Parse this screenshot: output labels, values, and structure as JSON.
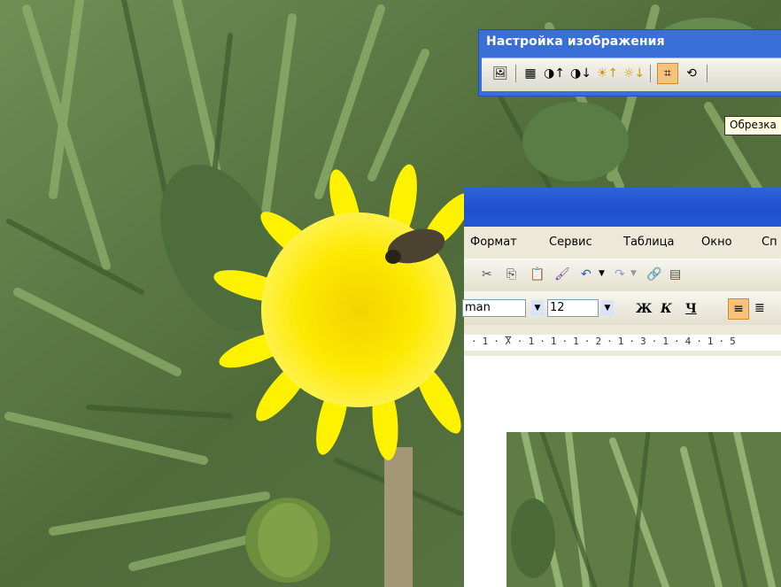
{
  "background": {
    "description_icon": "dandelion-photo"
  },
  "picture_toolbar": {
    "title": "Настройка изображения",
    "buttons": [
      {
        "name": "insert-picture-icon",
        "glyph": "🖼"
      },
      {
        "name": "color-icon",
        "glyph": "▦"
      },
      {
        "name": "more-contrast-icon",
        "glyph": "◑↑"
      },
      {
        "name": "less-contrast-icon",
        "glyph": "◑↓"
      },
      {
        "name": "more-brightness-icon",
        "glyph": "☀↑"
      },
      {
        "name": "less-brightness-icon",
        "glyph": "☼↓"
      },
      {
        "name": "crop-icon",
        "glyph": "⌗"
      },
      {
        "name": "rotate-icon",
        "glyph": "⟲"
      }
    ],
    "tooltip": "Обрезка"
  },
  "word": {
    "menu": [
      "Формат",
      "Сервис",
      "Таблица",
      "Окно",
      "Сп"
    ],
    "font_name": "man",
    "font_size": "12",
    "bold": "Ж",
    "italic": "К",
    "underline": "Ч",
    "ruler": "· 1 · Ⴟ · 1 · 1 · 1 · 2 · 1 · 3 · 1 · 4 · 1 · 5"
  },
  "colors": {
    "accent": "#3a6fd8",
    "title_bar": "#1f4fcf",
    "active_button": "#f6c37c"
  }
}
